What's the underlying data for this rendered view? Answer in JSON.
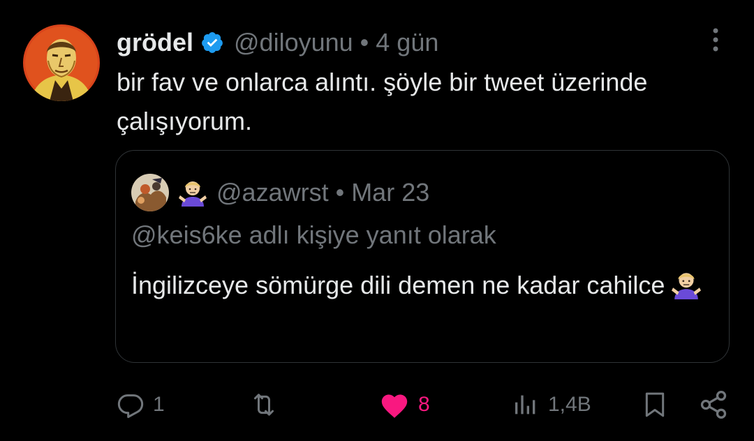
{
  "tweet": {
    "display_name": "grödel",
    "verified_icon": "verified-badge-icon",
    "handle": "@diloyunu",
    "separator": "•",
    "time": "4 gün",
    "text": "bir fav ve onlarca alıntı. şöyle bir tweet üzerinde çalışıyorum.",
    "more_icon": "more-vertical-icon"
  },
  "quote": {
    "handle": "@azawrst",
    "separator": "•",
    "time": "Mar 23",
    "name_emoji": "person-shrugging-emoji",
    "reply_to": "@keis6ke adlı kişiye yanıt olarak",
    "text": "İngilizceye sömürge dili demen ne kadar cahilce",
    "text_emoji": "person-shrugging-emoji"
  },
  "actions": {
    "reply": {
      "icon": "reply-icon",
      "count": "1"
    },
    "retweet": {
      "icon": "retweet-icon",
      "count": ""
    },
    "like": {
      "icon": "heart-icon",
      "count": "8"
    },
    "views": {
      "icon": "views-chart-icon",
      "count": "1,4B"
    },
    "bookmark": {
      "icon": "bookmark-icon"
    },
    "share": {
      "icon": "share-icon"
    }
  },
  "colors": {
    "background": "#000000",
    "primary_text": "#e7e9ea",
    "secondary_text": "#71767b",
    "border": "#2f3336",
    "verified_blue": "#1d9bf0",
    "like_pink": "#f91880"
  }
}
